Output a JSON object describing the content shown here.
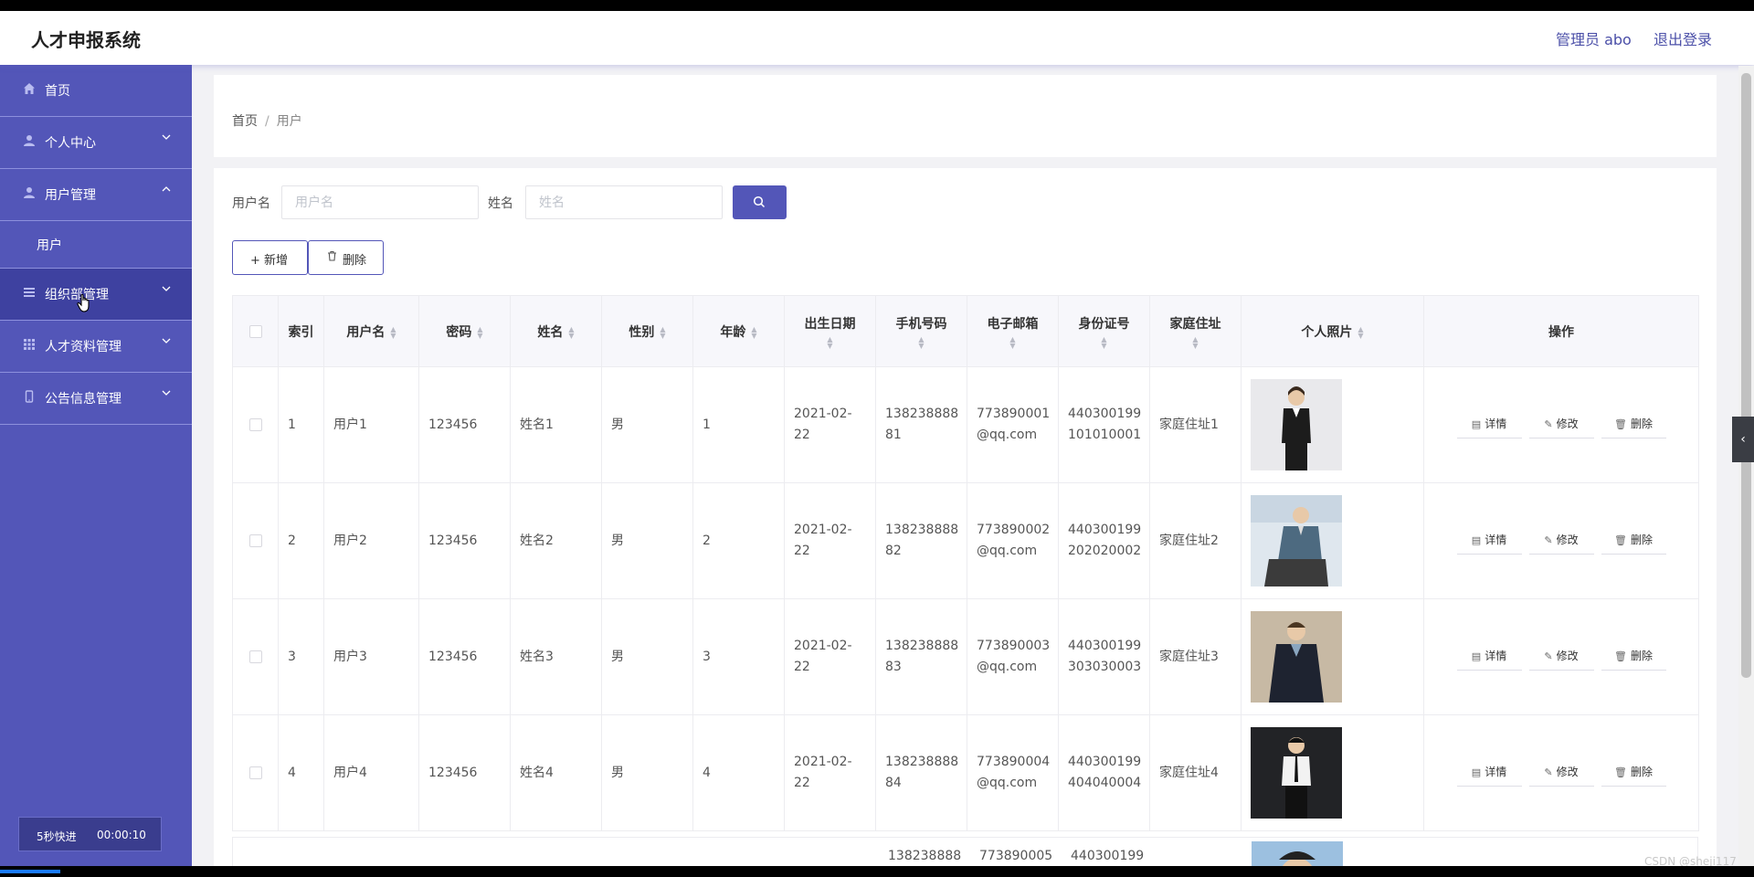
{
  "header": {
    "title": "人才申报系统",
    "admin_label": "管理员 abo",
    "logout_label": "退出登录"
  },
  "sidebar": {
    "items": [
      {
        "label": "首页",
        "icon": "home-icon",
        "chevron": ""
      },
      {
        "label": "个人中心",
        "icon": "user-icon",
        "chevron": "⌄"
      },
      {
        "label": "用户管理",
        "icon": "user-icon",
        "chevron": "⌃"
      },
      {
        "label": "组织部管理",
        "icon": "list-icon",
        "chevron": "⌄"
      },
      {
        "label": "人才资料管理",
        "icon": "grid-icon",
        "chevron": "⌄"
      },
      {
        "label": "公告信息管理",
        "icon": "mobile-icon",
        "chevron": "⌄"
      }
    ],
    "submenu": {
      "label": "用户"
    }
  },
  "speed": {
    "label": "5秒快进",
    "time": "00:00:10"
  },
  "breadcrumb": {
    "home": "首页",
    "sep": "/",
    "current": "用户"
  },
  "search": {
    "username_label": "用户名",
    "username_placeholder": "用户名",
    "name_label": "姓名",
    "name_placeholder": "姓名"
  },
  "toolbar": {
    "add_label": "+ 新增",
    "delete_label": "删除"
  },
  "table": {
    "headers": [
      "索引",
      "用户名",
      "密码",
      "姓名",
      "性别",
      "年龄",
      "出生日期",
      "手机号码",
      "电子邮箱",
      "身份证号",
      "家庭住址",
      "个人照片",
      "操作"
    ],
    "rows": [
      {
        "index": "1",
        "username": "用户1",
        "password": "123456",
        "name": "姓名1",
        "gender": "男",
        "age": "1",
        "birth": "2021-02-22",
        "phone1": "138238888",
        "phone2": "81",
        "email1": "773890001",
        "email2": "@qq.com",
        "id1": "440300199",
        "id2": "101010001",
        "addr": "家庭住址1"
      },
      {
        "index": "2",
        "username": "用户2",
        "password": "123456",
        "name": "姓名2",
        "gender": "男",
        "age": "2",
        "birth": "2021-02-22",
        "phone1": "138238888",
        "phone2": "82",
        "email1": "773890002",
        "email2": "@qq.com",
        "id1": "440300199",
        "id2": "202020002",
        "addr": "家庭住址2"
      },
      {
        "index": "3",
        "username": "用户3",
        "password": "123456",
        "name": "姓名3",
        "gender": "男",
        "age": "3",
        "birth": "2021-02-22",
        "phone1": "138238888",
        "phone2": "83",
        "email1": "773890003",
        "email2": "@qq.com",
        "id1": "440300199",
        "id2": "303030003",
        "addr": "家庭住址3"
      },
      {
        "index": "4",
        "username": "用户4",
        "password": "123456",
        "name": "姓名4",
        "gender": "男",
        "age": "4",
        "birth": "2021-02-22",
        "phone1": "138238888",
        "phone2": "84",
        "email1": "773890004",
        "email2": "@qq.com",
        "id1": "440300199",
        "id2": "404040004",
        "addr": "家庭住址4"
      }
    ],
    "actions": {
      "detail": "详情",
      "edit": "修改",
      "delete": "删除"
    },
    "partial_row": {
      "phone": "138238888",
      "email": "773890005",
      "id": "440300199"
    }
  },
  "watermark": "CSDN @sheji117",
  "colors": {
    "primary": "#5356b8",
    "sidebar_active": "#3e41a0"
  }
}
